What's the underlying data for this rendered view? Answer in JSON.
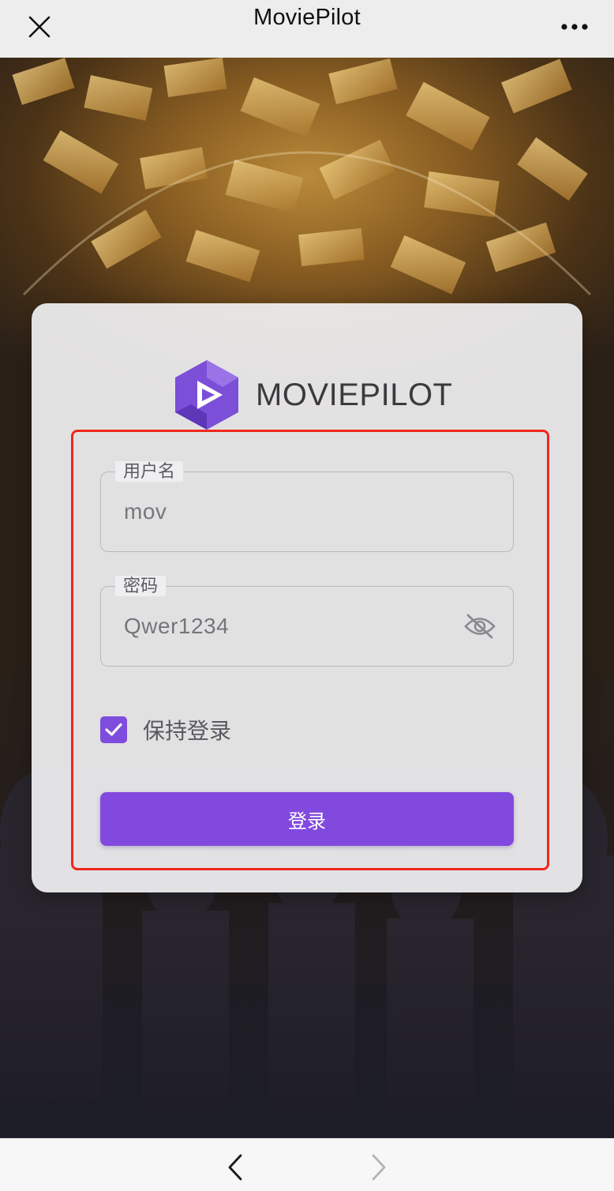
{
  "topbar": {
    "title": "MoviePilot",
    "close_icon": "close-icon",
    "more_icon": "more-dots-icon"
  },
  "brand": {
    "name": "MOVIEPILOT",
    "logo_color": "#7b4fd8"
  },
  "form": {
    "username": {
      "label": "用户名",
      "value": "mov"
    },
    "password": {
      "label": "密码",
      "value": "Qwer1234",
      "toggle_icon": "eye-off-icon"
    },
    "remember": {
      "label": "保持登录",
      "checked": true
    },
    "submit_label": "登录"
  },
  "colors": {
    "accent": "#8249df",
    "highlight_border": "#f0281e",
    "topbar_bg": "#ededed"
  },
  "bottombar": {
    "back_icon": "chevron-left-icon",
    "forward_icon": "chevron-right-icon"
  }
}
